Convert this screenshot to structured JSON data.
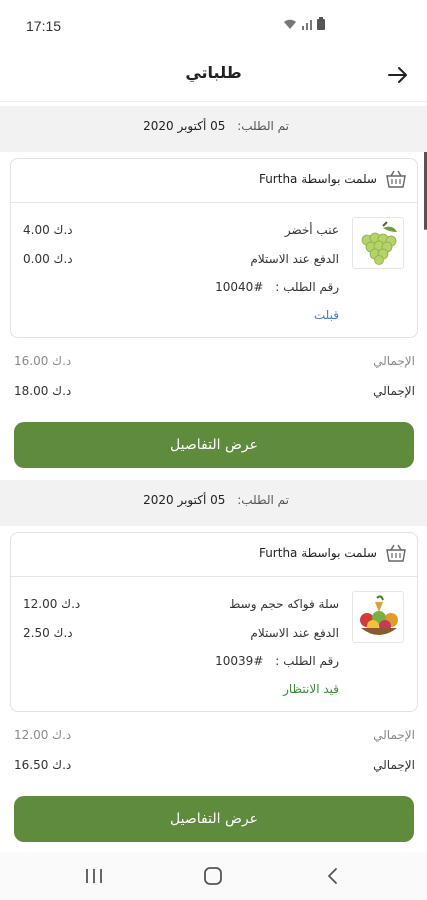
{
  "status_bar": {
    "time": "17:15"
  },
  "header": {
    "title": "طلباتي",
    "back_icon": "arrow-right-icon"
  },
  "orders": [
    {
      "date_label": "تم الطلب:",
      "date_value": "05 أكتوبر 2020",
      "store_label": "سلمت بواسطة Furtha",
      "product_name": "عنب أخضر",
      "product_price": "4.00 د.ك",
      "payment_method": "الدفع عند الاستلام",
      "payment_value": "0.00 د.ك",
      "order_number_label": "رقم الطلب :",
      "order_number": "#10040",
      "status": "قبلت",
      "subtotal_label": "الإجمالي",
      "subtotal_value": "16.00 د.ك",
      "total_label": "الإجمالي",
      "total_value": "18.00 د.ك",
      "details_button": "عرض التفاصيل"
    },
    {
      "date_label": "تم الطلب:",
      "date_value": "05 أكتوبر 2020",
      "store_label": "سلمت بواسطة Furtha",
      "product_name": "سلة فواكه حجم وسط",
      "product_price": "12.00 د.ك",
      "payment_method": "الدفع عند الاستلام",
      "payment_value": "2.50 د.ك",
      "order_number_label": "رقم الطلب :",
      "order_number": "#10039",
      "status": "قيد الانتظار",
      "subtotal_label": "الإجمالي",
      "subtotal_value": "12.00 د.ك",
      "total_label": "الإجمالي",
      "total_value": "16.50 د.ك",
      "details_button": "عرض التفاصيل"
    }
  ],
  "colors": {
    "accent": "#5e8b3c",
    "accepted": "#4a78c8",
    "pending": "#3a8a3a"
  }
}
